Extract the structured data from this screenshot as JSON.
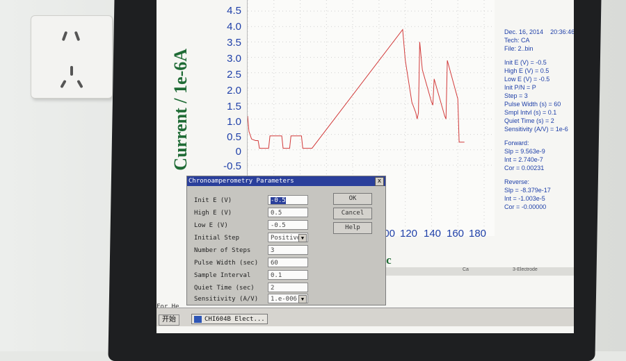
{
  "chart_data": {
    "type": "line",
    "ylabel": "Current / 1e-6A",
    "xlabel_fragment": "sec",
    "y_ticks": [
      "4.5",
      "4.0",
      "3.5",
      "3.0",
      "2.5",
      "2.0",
      "1.5",
      "1.0",
      "0.5",
      "0",
      "-0.5"
    ],
    "x_ticks": [
      "100",
      "120",
      "140",
      "160",
      "180"
    ],
    "ylim": [
      -0.5,
      4.5
    ],
    "xlim": [
      0,
      180
    ],
    "series": [
      {
        "values": [
          [
            0,
            1.1
          ],
          [
            1,
            0.6
          ],
          [
            3,
            0.35
          ],
          [
            6,
            0.3
          ],
          [
            8,
            0.3
          ],
          [
            9,
            0.05
          ],
          [
            16,
            0.05
          ],
          [
            17,
            0.45
          ],
          [
            26,
            0.45
          ],
          [
            27,
            0.05
          ],
          [
            32,
            0.05
          ],
          [
            33,
            0.45
          ],
          [
            41,
            0.45
          ],
          [
            42,
            0.05
          ],
          [
            49,
            0.05
          ],
          [
            118,
            3.9
          ],
          [
            120,
            2.9
          ],
          [
            125,
            1.55
          ],
          [
            128,
            1.2
          ],
          [
            129,
            1.0
          ],
          [
            130,
            1.2
          ],
          [
            131,
            3.5
          ],
          [
            133,
            2.6
          ],
          [
            140,
            1.55
          ],
          [
            141,
            1.45
          ],
          [
            142,
            2.3
          ],
          [
            150,
            1.1
          ],
          [
            151,
            1.0
          ],
          [
            152,
            2.9
          ],
          [
            160,
            1.65
          ],
          [
            161,
            0.25
          ],
          [
            165,
            0.25
          ]
        ]
      }
    ]
  },
  "info": {
    "date": "Dec. 16, 2014",
    "time": "20:36:46",
    "tech": "Tech: CA",
    "file": "File: 2..bin",
    "params": [
      "Init E (V) = -0.5",
      "High E (V) = 0.5",
      "Low E (V) = -0.5",
      "Init P/N = P",
      "Step = 3",
      "Pulse Width (s) = 60",
      "Smpl Intvl (s) = 0.1",
      "Quiet Time (s) = 2",
      "Sensitivity (A/V) = 1e-6"
    ],
    "forward_title": "Forward:",
    "forward": [
      "Slp = 9.563e-9",
      "Int = 2.740e-7",
      "Cor = 0.00231"
    ],
    "reverse_title": "Reverse:",
    "reverse": [
      "Slp = -8.379e-17",
      "Int = -1.003e-5",
      "Cor = -0.00000"
    ]
  },
  "dialog": {
    "title": "Chronoamperometry Parameters",
    "close": "x",
    "fields": [
      {
        "label": "Init E  (V)",
        "value": "-0.5",
        "selected": true
      },
      {
        "label": "High E  (V)",
        "value": "0.5"
      },
      {
        "label": "Low E  (V)",
        "value": "-0.5"
      },
      {
        "label": "Initial Step",
        "value": "Positive",
        "select": true
      },
      {
        "label": "Number of Steps",
        "value": "3"
      },
      {
        "label": "Pulse Width (sec)",
        "value": "60"
      },
      {
        "label": "Sample Interval",
        "value": "0.1"
      },
      {
        "label": "Quiet Time (sec)",
        "value": "2"
      },
      {
        "label": "Sensitivity (A/V)",
        "value": "1.e-006",
        "select": true
      }
    ],
    "ok": "OK",
    "cancel": "Cancel",
    "help": "Help"
  },
  "status": {
    "left": "Ca",
    "right": "3-Electrode"
  },
  "taskbar": {
    "for_help": "For He",
    "start": "开始",
    "app": "CHI604B Elect..."
  }
}
